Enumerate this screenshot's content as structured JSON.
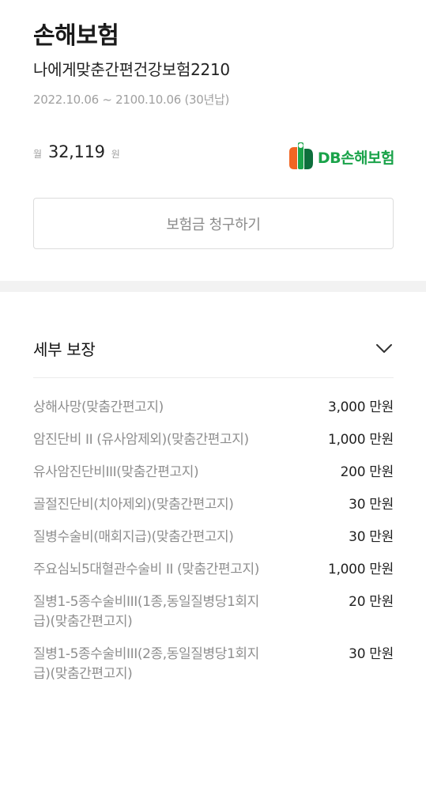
{
  "header": {
    "category": "손해보험",
    "product_name": "나에게맞춘간편건강보험2210",
    "period": "2022.10.06 ~ 2100.10.06 (30년납)"
  },
  "premium": {
    "prefix": "월",
    "amount": "32,119",
    "suffix": "원"
  },
  "insurer": {
    "logo_text": "DB손해보험",
    "brand_colors": [
      "#f26522",
      "#1aa34a",
      "#0d6f3c"
    ]
  },
  "claim_button": {
    "label": "보험금 청구하기"
  },
  "coverage": {
    "title": "세부 보장",
    "toggle_icon": "chevron-down-icon",
    "items": [
      {
        "name": "상해사망(맞춤간편고지)",
        "amount": "3,000 만원"
      },
      {
        "name": "암진단비 II (유사암제외)(맞춤간편고지)",
        "amount": "1,000 만원"
      },
      {
        "name": "유사암진단비III(맞춤간편고지)",
        "amount": "200 만원"
      },
      {
        "name": "골절진단비(치아제외)(맞춤간편고지)",
        "amount": "30 만원"
      },
      {
        "name": "질병수술비(매회지급)(맞춤간편고지)",
        "amount": "30 만원"
      },
      {
        "name": "주요심뇌5대혈관수술비 II (맞춤간편고지)",
        "amount": "1,000 만원"
      },
      {
        "name": "질병1-5종수술비III(1종,동일질병당1회지급)(맞춤간편고지)",
        "amount": "20 만원"
      },
      {
        "name": "질병1-5종수술비III(2종,동일질병당1회지급)(맞춤간편고지)",
        "amount": "30 만원"
      }
    ]
  }
}
